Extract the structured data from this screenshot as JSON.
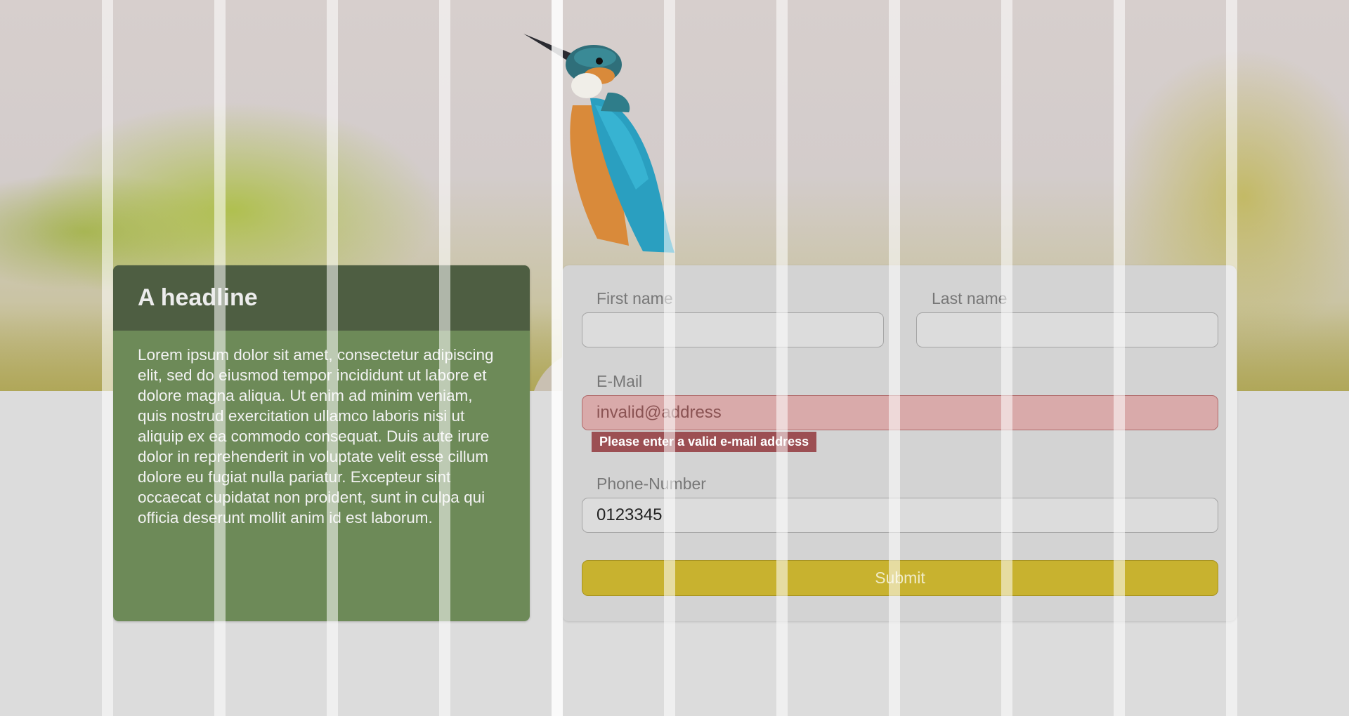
{
  "hero": {
    "image": "kingfisher bird perched, blurred background"
  },
  "left_card": {
    "headline": "A headline",
    "body": "Lorem ipsum dolor sit amet, consectetur adipiscing elit, sed do eiusmod tempor incididunt ut labore et dolore magna aliqua. Ut enim ad minim veniam, quis nostrud exercitation ullamco laboris nisi ut aliquip ex ea commodo consequat. Duis aute irure dolor in reprehenderit in voluptate velit esse cillum dolore eu fugiat nulla pariatur. Excepteur sint occaecat cupidatat non proident, sunt in culpa qui officia deserunt mollit anim id est laborum."
  },
  "form": {
    "first_name": {
      "label": "First name",
      "value": ""
    },
    "last_name": {
      "label": "Last name",
      "value": ""
    },
    "email": {
      "label": "E-Mail",
      "value": "invalid@address",
      "error": "Please enter a valid e-mail address"
    },
    "phone": {
      "label": "Phone-Number",
      "value": "0123345"
    },
    "submit_label": "Submit"
  },
  "colors": {
    "headline_bg": "#4e5e42",
    "card_bg": "#6d8a58",
    "form_bg": "#d3d3d3",
    "error_bg": "#9c4f53",
    "invalid_field_bg": "#d9aaaa",
    "submit_bg": "#c8b22f"
  }
}
